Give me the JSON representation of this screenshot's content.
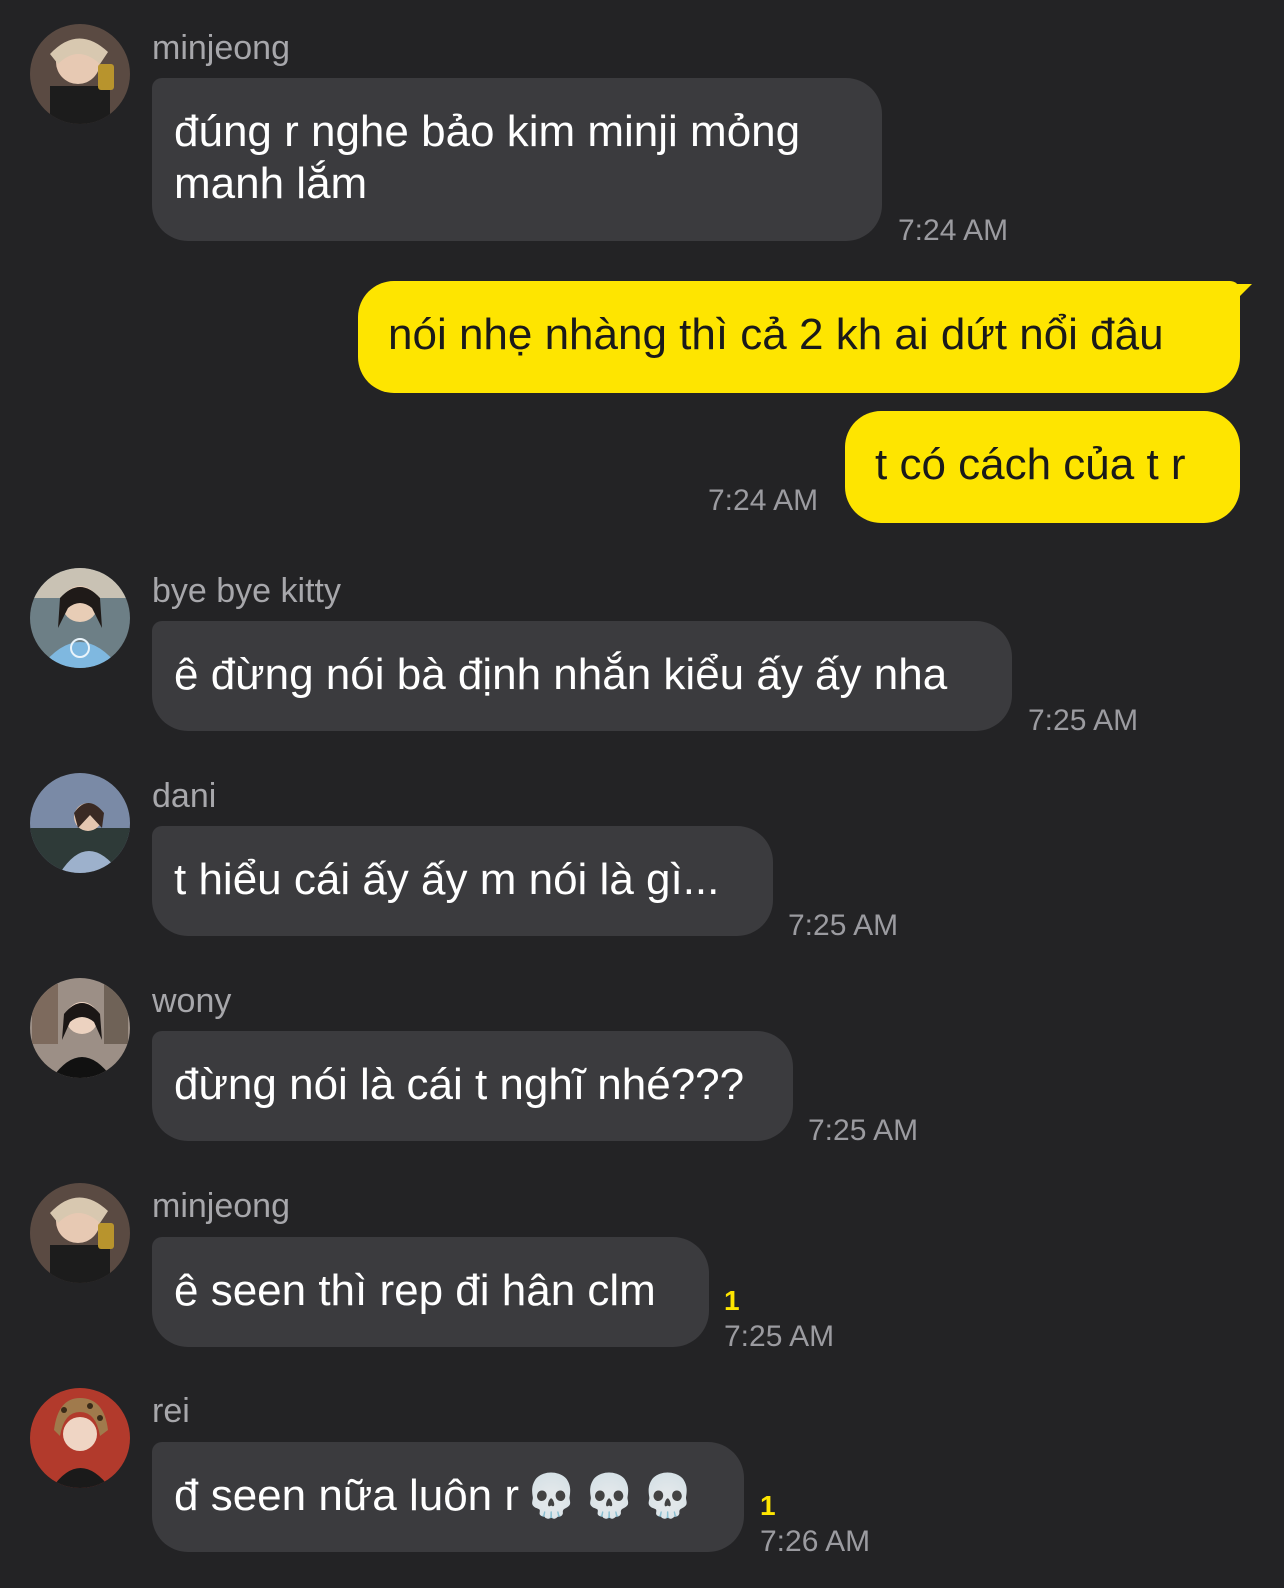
{
  "colors": {
    "background": "#232325",
    "incoming_bubble": "#3b3b3e",
    "outgoing_bubble": "#fee500",
    "unread": "#fee500"
  },
  "messages": [
    {
      "sender": "minjeong",
      "text_line1": "đúng r nghe bảo kim minji mỏng",
      "text_line2": "manh lắm",
      "time": "7:24 AM"
    },
    {
      "sender": "me",
      "text": "nói nhẹ nhàng thì cả 2 kh ai dứt nổi đâu"
    },
    {
      "sender": "me",
      "text": "t có cách của t r",
      "time": "7:24 AM"
    },
    {
      "sender": "bye bye kitty",
      "text": "ê đừng nói bà định nhắn kiểu ấy ấy nha",
      "time": "7:25 AM"
    },
    {
      "sender": "dani",
      "text": "t hiểu cái ấy ấy m nói là gì...",
      "time": "7:25 AM"
    },
    {
      "sender": "wony",
      "text": "đừng nói là cái t nghĩ nhé???",
      "time": "7:25 AM"
    },
    {
      "sender": "minjeong",
      "text": "ê seen thì rep đi hân clm",
      "unread": "1",
      "time": "7:25 AM"
    },
    {
      "sender": "rei",
      "text": "đ seen nữa luôn r",
      "emoji": [
        "💀",
        "💀",
        "💀"
      ],
      "unread": "1",
      "time": "7:26 AM"
    }
  ]
}
